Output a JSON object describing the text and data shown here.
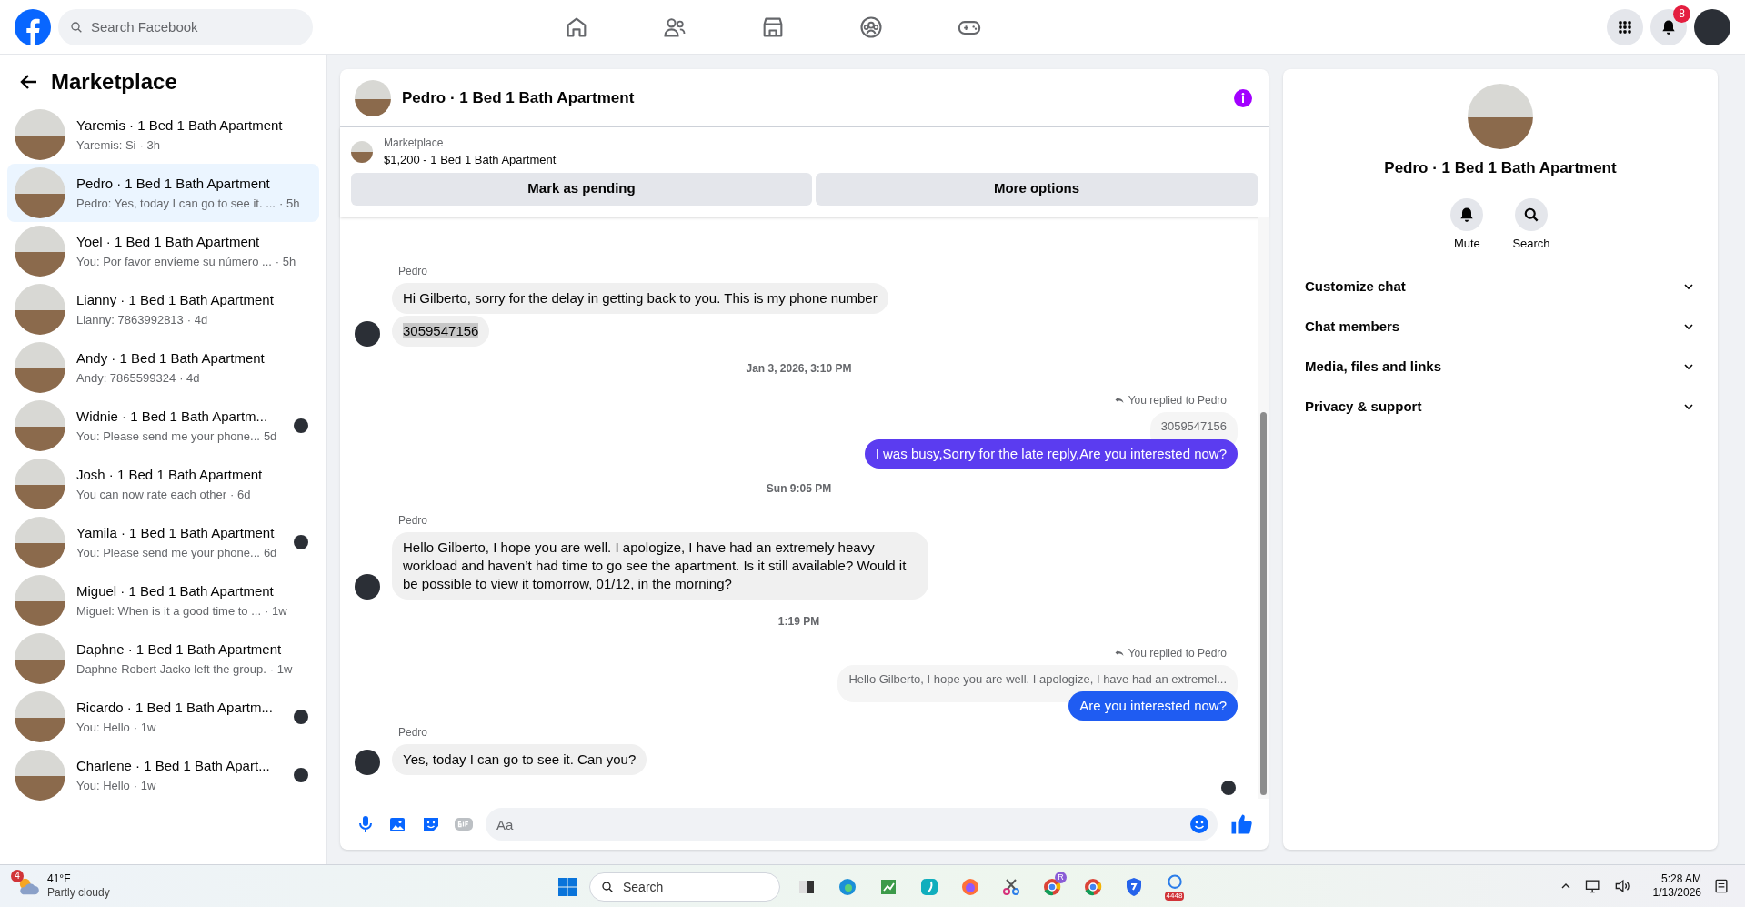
{
  "topbar": {
    "search_placeholder": "Search Facebook",
    "notification_count": "8"
  },
  "sidebar": {
    "title": "Marketplace",
    "conversations": [
      {
        "title": "Yaremis · 1 Bed 1 Bath Apartment",
        "preview": "Yaremis: Si",
        "time": "· 3h",
        "selected": false,
        "seen_avatar": false
      },
      {
        "title": "Pedro · 1 Bed 1 Bath Apartment",
        "preview": "Pedro: Yes, today I can go to see it. ...",
        "time": "· 5h",
        "selected": true,
        "seen_avatar": false
      },
      {
        "title": "Yoel · 1 Bed 1 Bath Apartment",
        "preview": "You: Por favor envíeme su número ...",
        "time": "· 5h",
        "selected": false,
        "seen_avatar": false
      },
      {
        "title": "Lianny · 1 Bed 1 Bath Apartment",
        "preview": "Lianny: 7863992813",
        "time": "· 4d",
        "selected": false,
        "seen_avatar": false
      },
      {
        "title": "Andy · 1 Bed 1 Bath Apartment",
        "preview": "Andy: 7865599324",
        "time": "· 4d",
        "selected": false,
        "seen_avatar": false
      },
      {
        "title": "Widnie · 1 Bed 1 Bath Apartm...",
        "preview": "You: Please send me your phone...",
        "time": "5d",
        "selected": false,
        "seen_avatar": true
      },
      {
        "title": "Josh · 1 Bed 1 Bath Apartment",
        "preview": "You can now rate each other",
        "time": "· 6d",
        "selected": false,
        "seen_avatar": false
      },
      {
        "title": "Yamila · 1 Bed 1 Bath Apartment",
        "preview": "You: Please send me your phone...",
        "time": "6d",
        "selected": false,
        "seen_avatar": true
      },
      {
        "title": "Miguel · 1 Bed 1 Bath Apartment",
        "preview": "Miguel: When is it a good time to ...",
        "time": "· 1w",
        "selected": false,
        "seen_avatar": false
      },
      {
        "title": "Daphne · 1 Bed 1 Bath Apartment",
        "preview": "Daphne Robert Jacko left the group.",
        "time": "· 1w",
        "selected": false,
        "seen_avatar": false
      },
      {
        "title": "Ricardo · 1 Bed 1 Bath Apartm...",
        "preview": "You: Hello",
        "time": "· 1w",
        "selected": false,
        "seen_avatar": true
      },
      {
        "title": "Charlene · 1 Bed 1 Bath Apart...",
        "preview": "You: Hello",
        "time": "· 1w",
        "selected": false,
        "seen_avatar": true
      }
    ]
  },
  "chat": {
    "title": "Pedro · 1 Bed 1 Bath Apartment",
    "listing": {
      "label": "Marketplace",
      "text": "$1,200 - 1 Bed 1 Bath Apartment"
    },
    "buttons": [
      "Mark as pending",
      "More options"
    ],
    "messages": [
      {
        "kind": "incoming",
        "sender": "Pedro",
        "bubbles": [
          {
            "text": "Hi Gilberto, sorry for the delay in getting back to you. This is my phone number",
            "highlighted": false
          },
          {
            "text": "3059547156",
            "highlighted": true
          }
        ]
      },
      {
        "kind": "timestamp",
        "text": "Jan 3, 2026, 3:10 PM"
      },
      {
        "kind": "outgoing",
        "reply_label": "You replied to Pedro",
        "quoted": "3059547156",
        "text": "I was busy,Sorry for the late reply,Are you interested now?",
        "color": "#5b3cf0"
      },
      {
        "kind": "timestamp",
        "text": "Sun 9:05 PM"
      },
      {
        "kind": "incoming",
        "sender": "Pedro",
        "bubbles": [
          {
            "text": "Hello Gilberto, I hope you are well. I apologize, I have had an extremely heavy workload and haven’t had time to go see the apartment. Is it still available? Would it be possible to view it tomorrow, 01/12, in the morning?",
            "highlighted": false
          }
        ]
      },
      {
        "kind": "timestamp",
        "text": "1:19 PM"
      },
      {
        "kind": "outgoing",
        "reply_label": "You replied to Pedro",
        "quoted": "Hello Gilberto, I hope you are well. I apologize, I have had an extremel...",
        "text": "Are you interested now?",
        "color": "#1f5cf2"
      },
      {
        "kind": "incoming",
        "sender": "Pedro",
        "bubbles": [
          {
            "text": "Yes, today I can go to see it. Can you?",
            "highlighted": false
          }
        ]
      }
    ],
    "composer_placeholder": "Aa"
  },
  "details": {
    "title": "Pedro · 1 Bed 1 Bath Apartment",
    "actions": [
      {
        "kind": "mute",
        "label": "Mute"
      },
      {
        "kind": "search",
        "label": "Search"
      }
    ],
    "sections": [
      {
        "label": "Customize chat",
        "expanded": false
      },
      {
        "label": "Chat members",
        "expanded": false
      },
      {
        "label": "Media, files and links",
        "expanded": false
      },
      {
        "label": "Privacy & support",
        "expanded": false
      }
    ]
  },
  "taskbar": {
    "weather_badge": "4",
    "temperature": "41°F",
    "condition": "Partly cloudy",
    "search_placeholder": "Search",
    "profile_badge": "R",
    "mail_badge": "4448",
    "time": "5:28 AM",
    "date": "1/13/2026"
  }
}
